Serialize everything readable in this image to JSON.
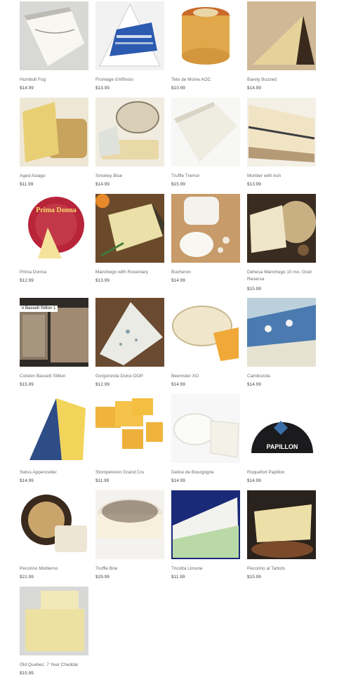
{
  "products": [
    {
      "name": "Humbolt Fog",
      "price": "$14.99",
      "icon": "humbolt-fog-image"
    },
    {
      "name": "Fromage d'Affinois",
      "price": "$13.99",
      "icon": "fromage-daffinois-image"
    },
    {
      "name": "Tete de Moine AOC",
      "price": "$10.99",
      "icon": "tete-de-moine-image"
    },
    {
      "name": "Barely Buzzed",
      "price": "$14.99",
      "icon": "barely-buzzed-image"
    },
    {
      "name": "Aged Asiago",
      "price": "$11.99",
      "icon": "aged-asiago-image"
    },
    {
      "name": "Smokey Blue",
      "price": "$14.99",
      "icon": "smokey-blue-image"
    },
    {
      "name": "Truffle Tremor",
      "price": "$15.99",
      "icon": "truffle-tremor-image"
    },
    {
      "name": "Morbier with Ash",
      "price": "$13.99",
      "icon": "morbier-image"
    },
    {
      "name": "Prima Donna",
      "price": "$12.99",
      "icon": "prima-donna-image",
      "image_text": "Prima Donna"
    },
    {
      "name": "Manchego with Rosemary",
      "price": "$13.99",
      "icon": "manchego-rosemary-image"
    },
    {
      "name": "Bucheron",
      "price": "$14.99",
      "icon": "bucheron-image"
    },
    {
      "name": "Dehesa Manchego 10 mo. Gran Reserva",
      "price": "$15.99",
      "icon": "dehesa-manchego-image"
    },
    {
      "name": "Colston Bassett Stilton",
      "price": "$15.99",
      "icon": "stilton-image",
      "image_text": "n Bassett Stilton 1"
    },
    {
      "name": "Gorgonzola Dolce DOP",
      "price": "$12.99",
      "icon": "gorgonzola-image"
    },
    {
      "name": "Beemster XO",
      "price": "$14.99",
      "icon": "beemster-image"
    },
    {
      "name": "Cambozola",
      "price": "$14.99",
      "icon": "cambozola-image"
    },
    {
      "name": "Swiss Appenzeller",
      "price": "$14.99",
      "icon": "appenzeller-image"
    },
    {
      "name": "Stompetoren Grand Cru",
      "price": "$11.99",
      "icon": "stompetoren-image"
    },
    {
      "name": "Delice de Bourgogne",
      "price": "$14.99",
      "icon": "delice-bourgogne-image"
    },
    {
      "name": "Roquefort Papillon",
      "price": "$14.99",
      "icon": "roquefort-image",
      "image_text": "PAPILLON"
    },
    {
      "name": "Pecorino Moliterno",
      "price": "$21.99",
      "icon": "moliterno-image"
    },
    {
      "name": "Truffle Brie",
      "price": "$29.99",
      "icon": "truffle-brie-image"
    },
    {
      "name": "Tricotta Limone",
      "price": "$11.99",
      "icon": "tricotta-limone-image"
    },
    {
      "name": "Pecorino al Tartufo",
      "price": "$15.99",
      "icon": "pecorino-tartufo-image"
    },
    {
      "name": "Old Quebec: 7 Year Cheddar",
      "price": "$15.99",
      "icon": "old-quebec-cheddar-image"
    }
  ]
}
